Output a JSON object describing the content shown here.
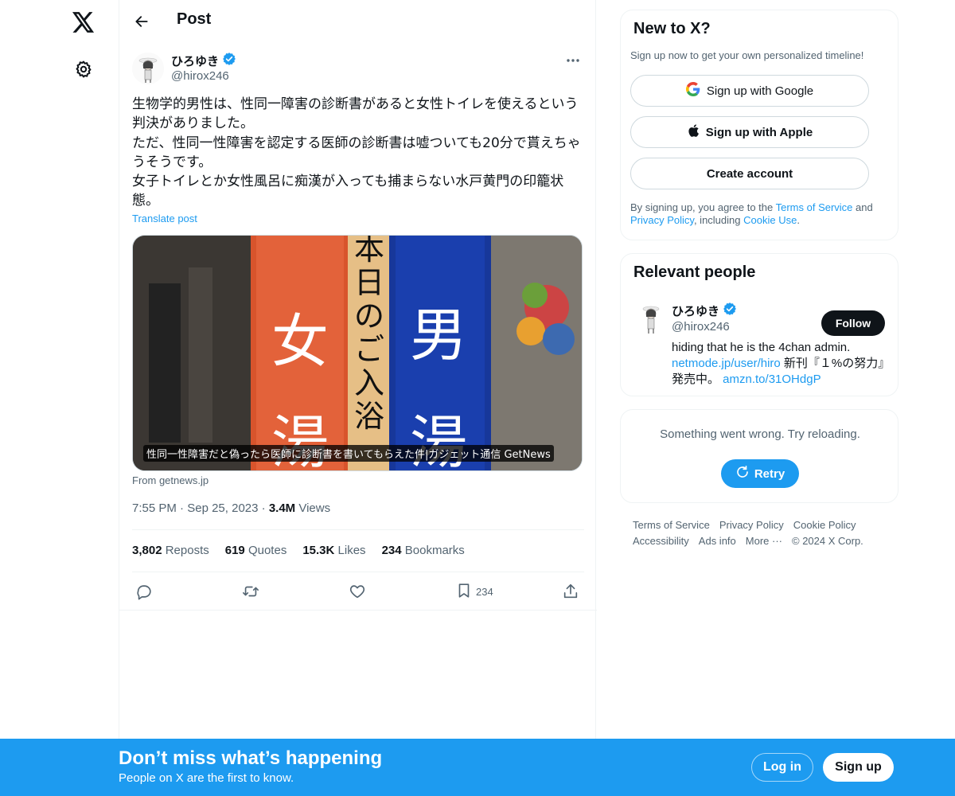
{
  "header": {
    "title": "Post"
  },
  "tweet": {
    "author_name": "ひろゆき",
    "author_handle": "@hirox246",
    "text_lines": [
      "生物学的男性は、性同一障害の診断書があると女性トイレを使えるという判決がありました。",
      "ただ、性同一性障害を認定する医師の診断書は嘘ついても20分で貰えちゃうそうです。",
      "女子トイレとか女性風呂に痴漢が入っても捕まらない水戸黄門の印籠状態。"
    ],
    "translate_label": "Translate post",
    "media_caption": "性同一性障害だと偽ったら医師に診断書を書いてもらえた件|ガジェット通信 GetNews",
    "media_source": "From getnews.jp",
    "time": "7:55 PM",
    "date": "Sep 25, 2023",
    "views_count": "3.4M",
    "views_label": "Views",
    "stats": [
      {
        "count": "3,802",
        "label": "Reposts"
      },
      {
        "count": "619",
        "label": "Quotes"
      },
      {
        "count": "15.3K",
        "label": "Likes"
      },
      {
        "count": "234",
        "label": "Bookmarks"
      }
    ],
    "bookmark_count": "234",
    "image_signs": {
      "left": "女湯",
      "center": "本日のご入浴",
      "right": "男湯"
    }
  },
  "signup_card": {
    "title": "New to X?",
    "subtitle": "Sign up now to get your own personalized timeline!",
    "google_label": "Sign up with Google",
    "apple_label": "Sign up with Apple",
    "create_label": "Create account",
    "terms_prefix": "By signing up, you agree to the ",
    "terms_link": "Terms of Service",
    "terms_and": " and ",
    "privacy_link": "Privacy Policy",
    "terms_including": ", including ",
    "cookie_link": "Cookie Use",
    "terms_suffix": "."
  },
  "relevant_people": {
    "title": "Relevant people",
    "name": "ひろゆき",
    "handle": "@hirox246",
    "follow_label": "Follow",
    "bio_text": "hiding that he is the 4chan admin.",
    "bio_link1": "netmode.jp/user/hiro",
    "bio_mid": " 新刊『１%の努力』発売中。 ",
    "bio_link2": "amzn.to/31OHdgP"
  },
  "error_card": {
    "message": "Something went wrong. Try reloading.",
    "retry_label": "Retry"
  },
  "footer": {
    "links": [
      "Terms of Service",
      "Privacy Policy",
      "Cookie Policy",
      "Accessibility",
      "Ads info",
      "More ···"
    ],
    "copyright": "© 2024 X Corp."
  },
  "bottom_bar": {
    "title": "Don’t miss what’s happening",
    "subtitle": "People on X are the first to know.",
    "login_label": "Log in",
    "signup_label": "Sign up"
  },
  "colors": {
    "accent": "#1d9bf0",
    "text": "#0f1419",
    "secondary": "#536471",
    "verified": "#1d9bf0"
  }
}
